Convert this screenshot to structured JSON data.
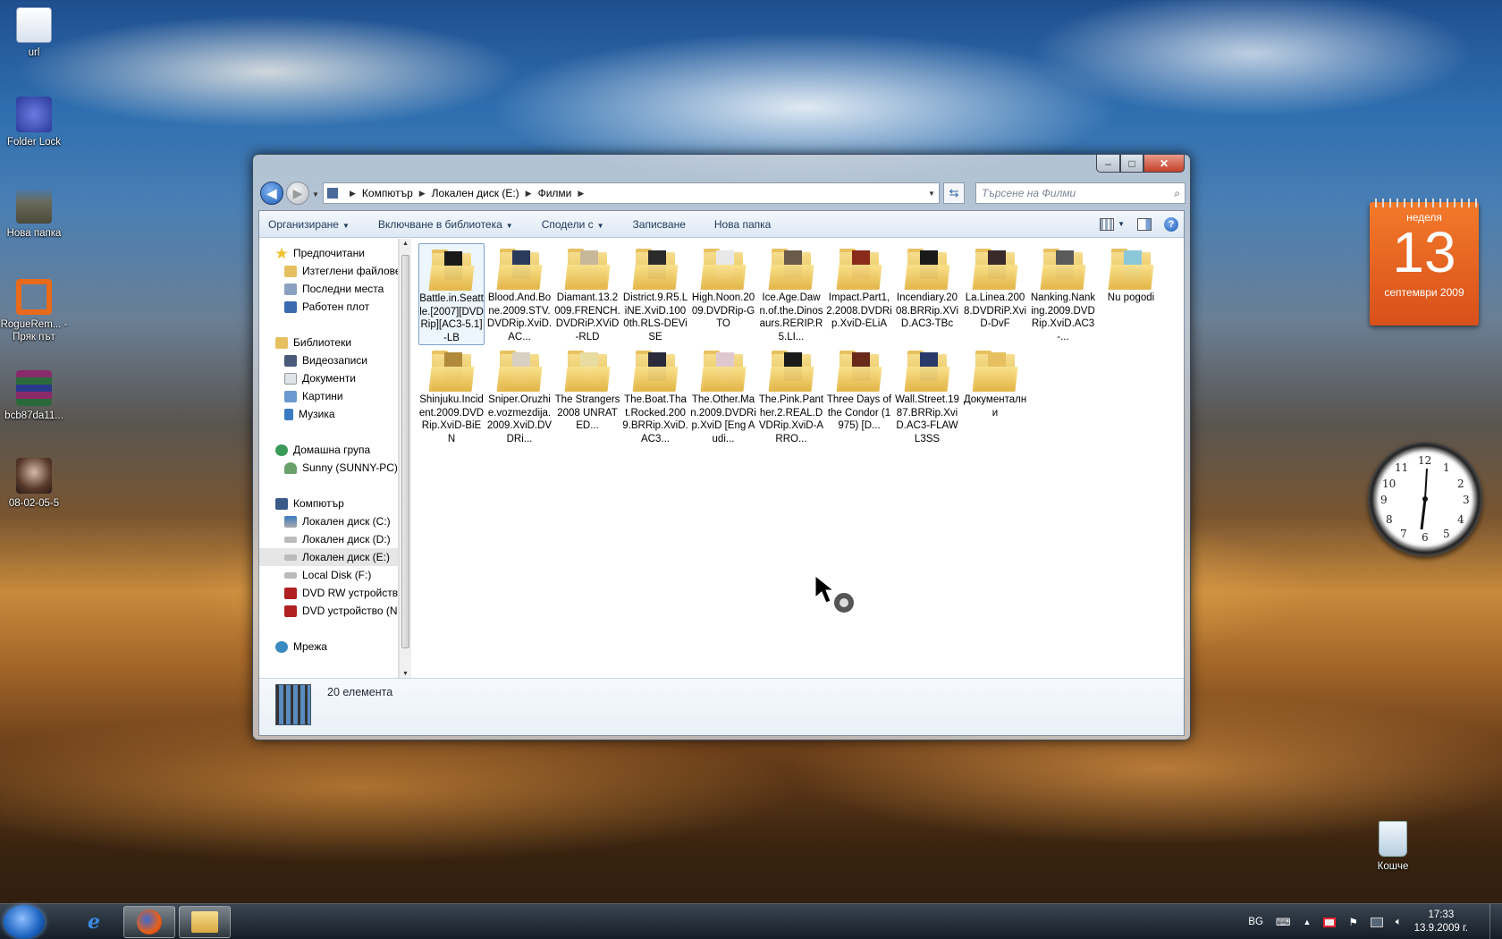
{
  "desktop": {
    "icons": [
      {
        "label": "url",
        "color": "#e8eef8"
      },
      {
        "label": "Folder Lock",
        "color": "#3a4db0"
      },
      {
        "label": "Нова папка",
        "color": "#7a7a6a"
      },
      {
        "label": "RogueRem... - Пряк път",
        "color": "#e86a1a"
      },
      {
        "label": "bcb87da11...",
        "color": "#8a2a6a"
      },
      {
        "label": "08-02-05-5",
        "color": "#6a4a3a"
      },
      {
        "label": "Кошче",
        "color": "#cfe0ee"
      }
    ]
  },
  "calendar_gadget": {
    "weekday": "неделя",
    "day": "13",
    "month_year": "септември 2009"
  },
  "clock_gadget": {
    "numerals": [
      "12",
      "1",
      "2",
      "3",
      "4",
      "5",
      "6",
      "7",
      "8",
      "9",
      "10",
      "11"
    ]
  },
  "window": {
    "caption": {
      "minimize": "–",
      "maximize": "□",
      "close": "✕"
    },
    "address": {
      "back": "◀",
      "forward": "▶",
      "crumbs": [
        "Компютър",
        "Локален диск (E:)",
        "Филми"
      ],
      "search_placeholder": "Търсене на Филми"
    },
    "toolbar": {
      "organize": "Организиране",
      "include": "Включване в библиотека",
      "share": "Сподели с",
      "burn": "Записване",
      "new_folder": "Нова папка"
    },
    "nav": {
      "favorites": "Предпочитани",
      "downloads": "Изтеглени файлове",
      "recent": "Последни места",
      "desktop": "Работен плот",
      "libraries": "Библиотеки",
      "videos": "Видеозаписи",
      "documents": "Документи",
      "pictures": "Картини",
      "music": "Музика",
      "homegroup": "Домашна група",
      "user": "Sunny (SUNNY-PC)",
      "computer": "Компютър",
      "disk_c": "Локален диск (C:)",
      "disk_d": "Локален диск (D:)",
      "disk_e": "Локален диск (E:)",
      "disk_f": "Local Disk  (F:)",
      "dvd_rw": "DVD RW устройство",
      "dvd": "DVD устройство (N",
      "network": "Мрежа"
    },
    "files": [
      {
        "name": "Battle.in.Seattle.[2007][DVDRip][AC3-5.1]-LB",
        "poster": "#1a1a1a"
      },
      {
        "name": "Blood.And.Bone.2009.STV.DVDRip.XviD.AC...",
        "poster": "#2a3a5a"
      },
      {
        "name": "Diamant.13.2009.FRENCH.DVDRiP.XViD-RLD",
        "poster": "#c8b89a"
      },
      {
        "name": "District.9.R5.LiNE.XviD.1000th.RLS-DEViSE",
        "poster": "#2a2a2a"
      },
      {
        "name": "High.Noon.2009.DVDRip-GTO",
        "poster": "#e8e8e8"
      },
      {
        "name": "Ice.Age.Dawn.of.the.Dinosaurs.RERIP.R5.LI...",
        "poster": "#6a5a4a"
      },
      {
        "name": "Impact.Part1,2.2008.DVDRip.XviD-ELiA",
        "poster": "#8a2a1a"
      },
      {
        "name": "Incendiary.2008.BRRip.XViD.AC3-TBc",
        "poster": "#1a1a1a"
      },
      {
        "name": "La.Linea.2008.DVDRiP.XviD-DvF",
        "poster": "#3a2a2a"
      },
      {
        "name": "Nanking.Nanking.2009.DVDRip.XviD.AC3-...",
        "poster": "#5a5a5a"
      },
      {
        "name": "Nu pogodi",
        "poster": "#8ac8d8"
      },
      {
        "name": "Shinjuku.Incident.2009.DVDRip.XviD-BiEN",
        "poster": "#b08a3a"
      },
      {
        "name": "Sniper.Oruzhie.vozmezdija.2009.XviD.DVDRi...",
        "poster": "#d8d0c0"
      },
      {
        "name": "The Strangers 2008 UNRATED...",
        "poster": "#e8dca0"
      },
      {
        "name": "The.Boat.That.Rocked.2009.BRRip.XviD.AC3...",
        "poster": "#2a2a3a"
      },
      {
        "name": "The.Other.Man.2009.DVDRip.XviD [Eng Audi...",
        "poster": "#e0c8d0"
      },
      {
        "name": "The.Pink.Panther.2.REAL.DVDRip.XviD-ARRO...",
        "poster": "#1a1a1a"
      },
      {
        "name": "Three Days of the Condor (1975) [D...",
        "poster": "#6a2a1a"
      },
      {
        "name": "Wall.Street.1987.BRRip.XviD.AC3-FLAWL3SS",
        "poster": "#2a3a6a"
      },
      {
        "name": "Документални",
        "poster": "#e6c060"
      }
    ],
    "status": {
      "count": "20 елемента"
    }
  },
  "taskbar": {
    "language": "BG",
    "time": "17:33",
    "date": "13.9.2009 г."
  }
}
